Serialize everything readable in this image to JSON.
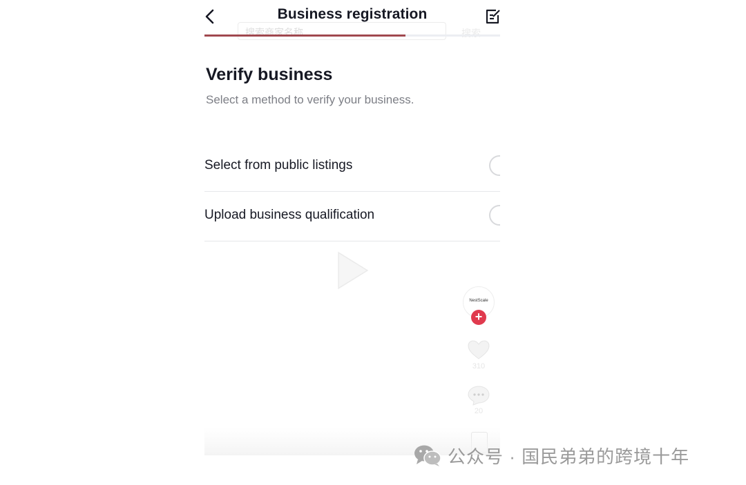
{
  "header": {
    "title": "Business registration",
    "progress_fraction": 0.68,
    "progress_color": "#a0484f"
  },
  "ghost": {
    "search_text": "搜索商家名称",
    "search_button": "搜索"
  },
  "section": {
    "title": "Verify business",
    "subtitle": "Select a method to verify your business."
  },
  "options": [
    {
      "label": "Select from public listings",
      "selected": false
    },
    {
      "label": "Upload business qualification",
      "selected": false
    }
  ],
  "side": {
    "avatar_text": "NestScale",
    "likes": "310",
    "comments": "20"
  },
  "watermark": {
    "text": "公众号 · 国民弟弟的跨境十年"
  },
  "colors": {
    "accent_red": "#e03a4e",
    "text_primary": "#161823",
    "text_secondary": "#7c7e85"
  }
}
